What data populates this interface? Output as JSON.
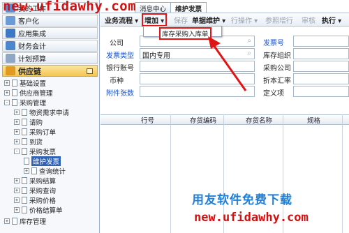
{
  "watermark": {
    "top_url": "new.ufidawhy.com",
    "bottom_text": "用友软件免费下载",
    "bottom_url": "new.ufidawhy.com"
  },
  "tabs": [
    {
      "label": "消息中心"
    },
    {
      "label": "维护发票"
    }
  ],
  "left_nav": {
    "top_items": [
      {
        "label": "我的工作",
        "icon": "work-icon"
      },
      {
        "label": "客户化",
        "icon": "customize-icon"
      },
      {
        "label": "应用集成",
        "icon": "integration-icon"
      },
      {
        "label": "财务会计",
        "icon": "finance-icon"
      },
      {
        "label": "计划预算",
        "icon": "budget-icon"
      },
      {
        "label": "供应链",
        "icon": "supply-chain-icon"
      }
    ],
    "tree": [
      {
        "label": "基础设置",
        "toggle": "+"
      },
      {
        "label": "供应商管理",
        "toggle": "+"
      },
      {
        "label": "采购管理",
        "toggle": "-"
      },
      {
        "label": "物资需求申请",
        "toggle": "+"
      },
      {
        "label": "请购",
        "toggle": "+"
      },
      {
        "label": "采购订单",
        "toggle": "+"
      },
      {
        "label": "到货",
        "toggle": "+"
      },
      {
        "label": "采购发票",
        "toggle": "-"
      },
      {
        "label": "维护发票",
        "toggle": ""
      },
      {
        "label": "查询统计",
        "toggle": "+"
      },
      {
        "label": "采购结算",
        "toggle": "+"
      },
      {
        "label": "采购查询",
        "toggle": "+"
      },
      {
        "label": "采购价格",
        "toggle": "+"
      },
      {
        "label": "价格结算单",
        "toggle": "+"
      },
      {
        "label": "库存管理",
        "toggle": "+"
      }
    ]
  },
  "toolbar": {
    "business_flow": "业务流程",
    "add": "增加",
    "save": "保存",
    "document_maintain": "单据维护",
    "row_operation": "行操作",
    "copy_row": "参照增行",
    "review": "审核",
    "execute": "执行",
    "dropdown_item": "库存采购入库单"
  },
  "form": {
    "company_label": "公司",
    "company_value": "",
    "invoice_type_label": "发票类型",
    "invoice_type_value": "国内专用",
    "bank_account_label": "银行账号",
    "currency_label": "币种",
    "attachment_label": "附件张数",
    "invoice_no_label": "发票号",
    "stock_org_label": "库存组织",
    "purchase_company_label": "采购公司",
    "exchange_rate_label": "折本汇率",
    "custom_label": "定义项"
  },
  "grid": {
    "columns": [
      "行号",
      "存货编码",
      "存货名称",
      "规格"
    ]
  },
  "colors": {
    "accent_red": "#e01515",
    "label_blue": "#1a52c6",
    "active_nav": "#f4c552",
    "watermark_blue": "#1f7fd6"
  }
}
